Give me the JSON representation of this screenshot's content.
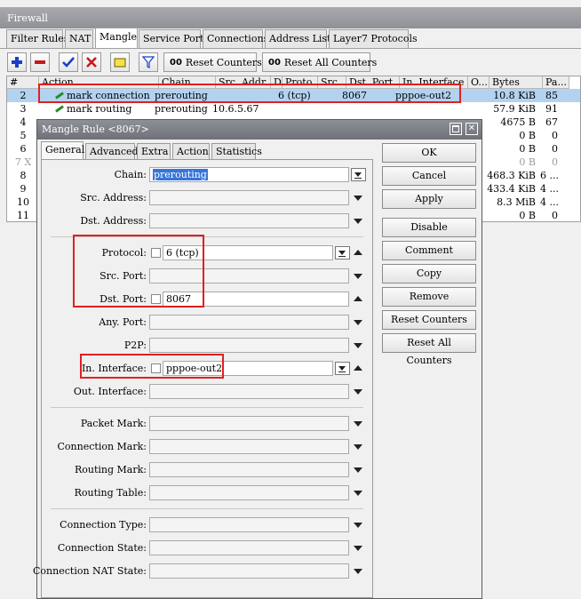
{
  "window": {
    "title": "Firewall"
  },
  "tabs": [
    "Filter Rules",
    "NAT",
    "Mangle",
    "Service Ports",
    "Connections",
    "Address Lists",
    "Layer7 Protocols"
  ],
  "toolbar": {
    "reset_counters": "Reset Counters",
    "reset_all_counters": "Reset All Counters",
    "oo": "00"
  },
  "table": {
    "columns": [
      "#",
      "Action",
      "Chain",
      "Src. Addr...",
      "D...",
      "Proto...",
      "Src...",
      "Dst. Port",
      "In. Interface",
      "O...",
      "Bytes",
      "Pa..."
    ],
    "rows": [
      {
        "n": "2",
        "action": "mark connection",
        "chain": "prerouting",
        "src": "",
        "proto": "6 (tcp)",
        "dst": "8067",
        "iface": "pppoe-out2",
        "bytes": "10.8 KiB",
        "pa": "85"
      },
      {
        "n": "3",
        "action": "mark routing",
        "chain": "prerouting",
        "src": "10.6.5.67",
        "proto": "",
        "dst": "",
        "iface": "",
        "bytes": "57.9 KiB",
        "pa": "91"
      },
      {
        "n": "4",
        "action": "",
        "chain": "",
        "src": "",
        "proto": "",
        "dst": "",
        "iface": "",
        "bytes": "4675 B",
        "pa": "67"
      },
      {
        "n": "5",
        "action": "",
        "chain": "",
        "src": "",
        "proto": "",
        "dst": "",
        "iface": "",
        "bytes": "0 B",
        "pa": "0"
      },
      {
        "n": "6",
        "action": "",
        "chain": "",
        "src": "",
        "proto": "",
        "dst": "",
        "iface": "",
        "bytes": "0 B",
        "pa": "0"
      },
      {
        "n": "7 X",
        "action": "",
        "chain": "",
        "src": "",
        "proto": "",
        "dst": "",
        "iface": "",
        "bytes": "0 B",
        "pa": "0"
      },
      {
        "n": "8",
        "action": "",
        "chain": "",
        "src": "",
        "proto": "",
        "dst": "",
        "iface": "",
        "bytes": "468.3 KiB",
        "pa": "6 ..."
      },
      {
        "n": "9",
        "action": "",
        "chain": "",
        "src": "",
        "proto": "",
        "dst": "",
        "iface": "",
        "bytes": "433.4 KiB",
        "pa": "4 ..."
      },
      {
        "n": "10",
        "action": "",
        "chain": "",
        "src": "",
        "proto": "",
        "dst": "",
        "iface": "",
        "bytes": "8.3 MiB",
        "pa": "4 ..."
      },
      {
        "n": "11",
        "action": "",
        "chain": "",
        "src": "",
        "proto": "",
        "dst": "",
        "iface": "",
        "bytes": "0 B",
        "pa": "0"
      }
    ]
  },
  "dialog": {
    "title": "Mangle Rule <8067>",
    "tabs": [
      "General",
      "Advanced",
      "Extra",
      "Action",
      "Statistics"
    ],
    "labels": {
      "chain": "Chain:",
      "src_address": "Src. Address:",
      "dst_address": "Dst. Address:",
      "protocol": "Protocol:",
      "src_port": "Src. Port:",
      "dst_port": "Dst. Port:",
      "any_port": "Any. Port:",
      "p2p": "P2P:",
      "in_interface": "In. Interface:",
      "out_interface": "Out. Interface:",
      "packet_mark": "Packet Mark:",
      "connection_mark": "Connection Mark:",
      "routing_mark": "Routing Mark:",
      "routing_table": "Routing Table:",
      "connection_type": "Connection Type:",
      "connection_state": "Connection State:",
      "connection_nat_state": "Connection NAT State:"
    },
    "values": {
      "chain": "prerouting",
      "protocol": "6 (tcp)",
      "dst_port": "8067",
      "in_interface": "pppoe-out2"
    },
    "buttons": [
      "OK",
      "Cancel",
      "Apply",
      "Disable",
      "Comment",
      "Copy",
      "Remove",
      "Reset Counters",
      "Reset All Counters"
    ]
  },
  "colors": {
    "highlight": "#e02020",
    "selection": "#b3d2f0",
    "titlebar": "#7a7c83"
  }
}
